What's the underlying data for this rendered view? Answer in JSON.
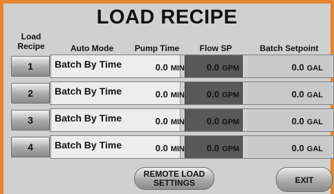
{
  "title": "LOAD RECIPE",
  "headers": {
    "load_recipe": "Load Recipe",
    "auto_mode": "Auto Mode",
    "pump_time": "Pump Time",
    "flow_sp": "Flow SP",
    "batch_setpoint": "Batch Setpoint"
  },
  "rows": [
    {
      "recipe": "1",
      "mode": "Batch By Time",
      "pump_time": "0.0",
      "pump_unit": "MIN",
      "flow_sp": "0.0",
      "flow_unit": "GPM",
      "batch": "0.0",
      "batch_unit": "GAL"
    },
    {
      "recipe": "2",
      "mode": "Batch By Time",
      "pump_time": "0.0",
      "pump_unit": "MIN",
      "flow_sp": "0.0",
      "flow_unit": "GPM",
      "batch": "0.0",
      "batch_unit": "GAL"
    },
    {
      "recipe": "3",
      "mode": "Batch By Time",
      "pump_time": "0.0",
      "pump_unit": "MIN",
      "flow_sp": "0.0",
      "flow_unit": "GPM",
      "batch": "0.0",
      "batch_unit": "GAL"
    },
    {
      "recipe": "4",
      "mode": "Batch By Time",
      "pump_time": "0.0",
      "pump_unit": "MIN",
      "flow_sp": "0.0",
      "flow_unit": "GPM",
      "batch": "0.0",
      "batch_unit": "GAL"
    }
  ],
  "buttons": {
    "remote_load_settings": "REMOTE LOAD SETTINGS",
    "exit": "EXIT"
  },
  "colors": {
    "frame": "#e8852c",
    "panel": "#d0d0d0",
    "flow_cell": "#595959"
  }
}
